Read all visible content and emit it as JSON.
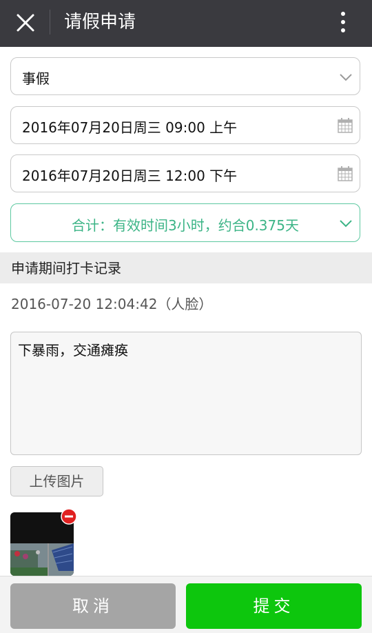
{
  "header": {
    "title": "请假申请",
    "close_icon": "close-icon",
    "more_icon": "more-vertical-icon",
    "background": "#3a3a3f"
  },
  "leave_type": {
    "value": "事假",
    "icon": "chevron-down-icon"
  },
  "start_time": {
    "value": "2016年07月20日周三 09:00 上午",
    "icon": "calendar-icon"
  },
  "end_time": {
    "value": "2016年07月20日周三 12:00 下午",
    "icon": "calendar-icon"
  },
  "summary": {
    "text": "合计：有效时间3小时，约合0.375天",
    "color": "#3bb486",
    "icon": "chevron-down-icon"
  },
  "clock_records": {
    "heading": "申请期间打卡记录",
    "items": [
      "2016-07-20 12:04:42（人脸）"
    ]
  },
  "reason": {
    "value": "下暴雨，交通瘫痪"
  },
  "upload": {
    "label": "上传图片"
  },
  "attachment": {
    "remove_icon": "remove-icon",
    "remove_color": "#e02020"
  },
  "footer": {
    "cancel_label": "取消",
    "submit_label": "提交",
    "cancel_color": "#a5a5a5",
    "submit_color": "#0dc60d"
  }
}
